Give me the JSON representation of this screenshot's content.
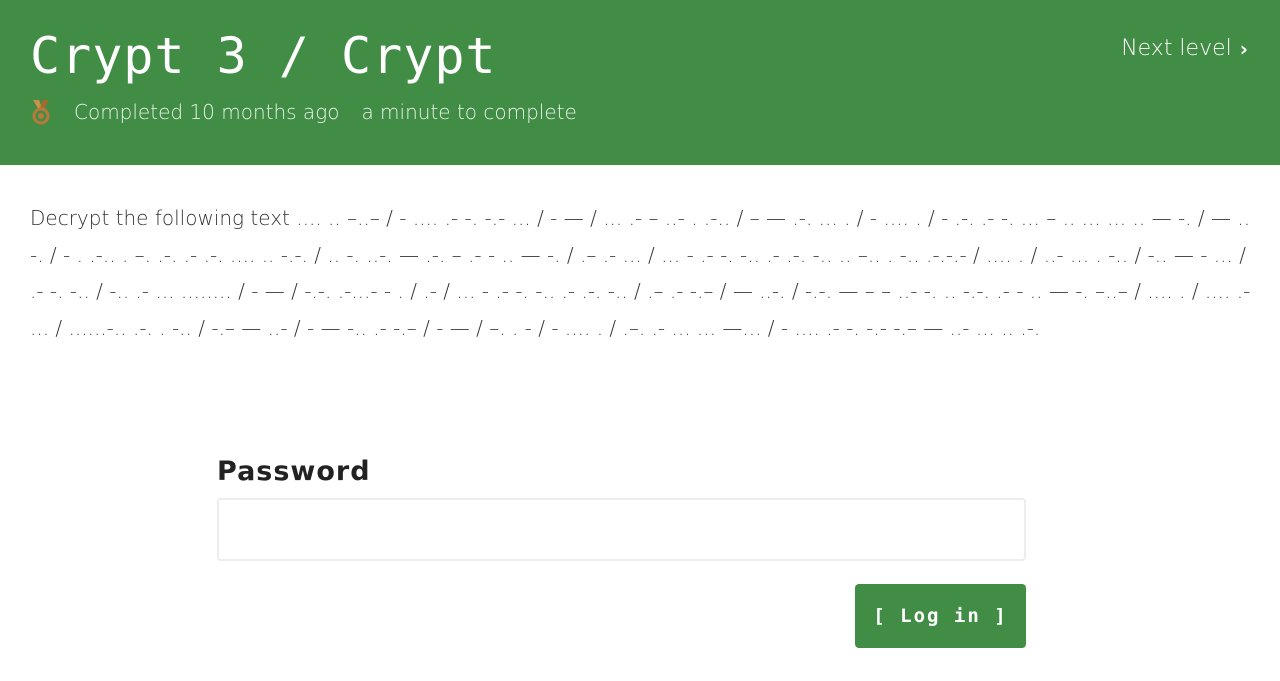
{
  "header": {
    "title": "Crypt 3 / Crypt",
    "next_level": "Next level",
    "completed": "Completed 10 months ago",
    "duration": "a minute to complete",
    "medal_icon": "medal-icon",
    "colors": {
      "header_bg": "#418d45",
      "medal": "#b87a3a"
    }
  },
  "challenge": {
    "description": "Decrypt the following text .... .. –..– / - .... .- -. -.- ... / - — / ... .- – ..- . .-.. / – — .-. ... . / - .... . / - .-. .- -. ... – .. ... ... .. — -. / — ..-. / - . .-.. . –. .-. .- .-. .... .. -.-. / .. -. ..-. — .-. – .- - .. — -. / .– .- ... / ... - .- -. -.. .- .-. -.. .. –.. . -.. .-.-.- / .... . / ..- ... . -.. / -.. — - ... / .- -. -.. / -.. .- ... ........ / - — / -.-. .-...- - . / .- / ... - .- -. -.. .- .-. -.. / .– .- -.– / — ..-. / -.-. — – – ..- -. .. -.-. .- - .. — -. –..– / .... . / .... .- ... / ......-.. .-. . -.. / -.– — ..- / - — -.. .- -.– / - — / –. . - / - .... . / .–. .- ... ... —... / - .... .- -. -.- -.– — ..- ... .. .-."
  },
  "form": {
    "password_label": "Password",
    "password_value": "",
    "password_placeholder": "",
    "login_label": "[ Log in ]",
    "accent": "#418d45"
  }
}
